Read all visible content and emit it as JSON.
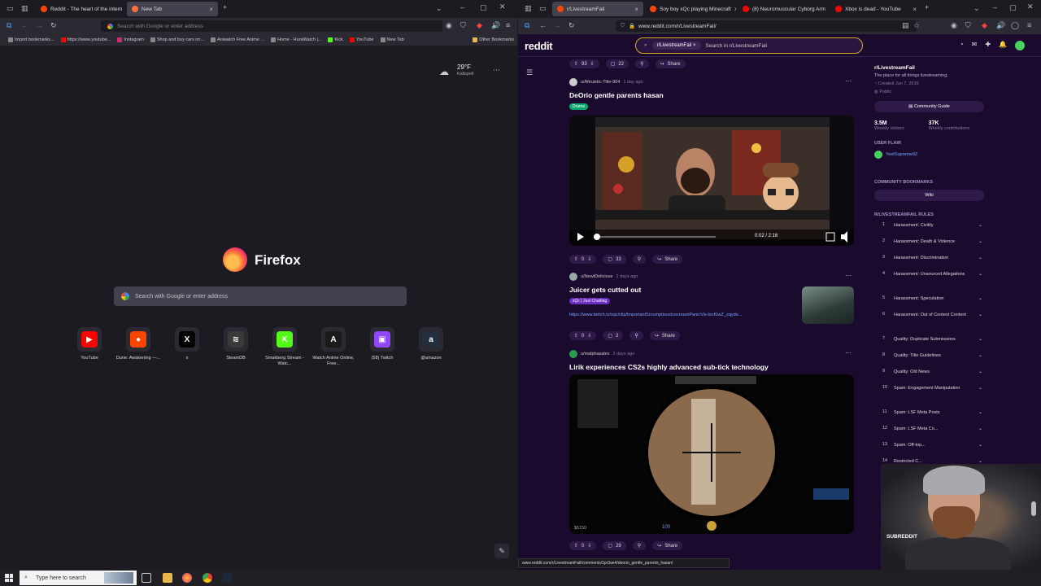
{
  "left_window": {
    "tabs": [
      {
        "label": "Reddit - The heart of the intern",
        "active": false
      },
      {
        "label": "New Tab",
        "active": true
      }
    ],
    "url_placeholder": "Search with Google or enter address",
    "bookmarks": [
      "Import bookmarks...",
      "https://www.youtube...",
      "Instagram",
      "Shop and buy cars on...",
      "Aniwatch Free Anime ...",
      "Home - HuraWatch |...",
      "Kick",
      "YouTube",
      "New Tab"
    ],
    "bookmarks_other": "Other Bookmarks",
    "weather": {
      "temp": "29°F",
      "city": "Kalispell"
    },
    "brand": "Firefox",
    "search_placeholder": "Search with Google or enter address",
    "shortcuts": [
      {
        "label": "YouTube",
        "color": "#ff0000",
        "glyph": "▶"
      },
      {
        "label": "Dune: Awakening —...",
        "color": "#ff4500",
        "glyph": "●"
      },
      {
        "label": "x",
        "color": "#000000",
        "glyph": "X"
      },
      {
        "label": "SteamDB",
        "color": "#3a3a3a",
        "glyph": "≋"
      },
      {
        "label": "Smakberg Stream - Watc...",
        "color": "#53fc18",
        "glyph": "K"
      },
      {
        "label": "Watch Anime Online, Free...",
        "color": "#1a1a1a",
        "glyph": "A"
      },
      {
        "label": "(58) Twitch",
        "color": "#9146ff",
        "glyph": "▣"
      },
      {
        "label": "@amazon",
        "color": "#232f3e",
        "glyph": "a"
      }
    ]
  },
  "right_window": {
    "tabs": [
      {
        "label": "r/LivestreamFail",
        "active": true
      },
      {
        "label": "Soy boy xQc playing Minecraft",
        "active": false
      },
      {
        "label": "(8) Neuromuscular Cyborg Arm",
        "active": false
      },
      {
        "label": "Xbox is dead - YouTube",
        "active": false
      }
    ],
    "url": "www.reddit.com/r/LivestreamFail/",
    "reddit": {
      "logo": "reddit",
      "search_chip": "r/LivestreamFail",
      "search_placeholder": "Search in r/LivestreamFail"
    },
    "feed": {
      "top_bar": {
        "votes": "93",
        "comments": "22",
        "share": "Share"
      },
      "posts": [
        {
          "author": "u/Altruistic-Title-904",
          "time": "1 day ago",
          "title": "DeOrio gentle parents hasan",
          "flair": "Drama",
          "video_time": "0:02 / 2:16",
          "votes": "0",
          "comments": "33",
          "share": "Share"
        },
        {
          "author": "u/NewtDelicious",
          "time": "2 days ago",
          "title": "Juicer gets cutted out",
          "flair": "xQc | Just Chatting",
          "link": "https://www.twitch.tv/xqc/clip/ImportantScrumptiousIcecreamPanicVis-locKtwZ_zqyde...",
          "votes": "0",
          "comments": "2",
          "share": "Share"
        },
        {
          "author": "u/malphasalex",
          "time": "2 days ago",
          "title": "Lirik experiences CS2s highly advanced sub-tick technology",
          "hud_money": "$5150",
          "hud_hp": "100",
          "votes": "0",
          "comments": "29",
          "share": "Share"
        }
      ]
    },
    "sidebar": {
      "title": "r/LivestreamFail",
      "description": "The place for all things livestreaming.",
      "created": "Created Jun 7, 2015",
      "visibility": "Public",
      "guide_button": "Community Guide",
      "stats": [
        {
          "value": "3.5M",
          "label": "Weekly visitors"
        },
        {
          "value": "37K",
          "label": "Weekly contributions"
        }
      ],
      "user_flair_heading": "USER FLAIR",
      "user_flair_name": "YeetSupreme92",
      "bookmarks_heading": "COMMUNITY BOOKMARKS",
      "wiki": "Wiki",
      "rules_heading": "R/LIVESTREAMFAIL RULES",
      "rules": [
        {
          "n": "1",
          "t": "Harassment: Civility"
        },
        {
          "n": "2",
          "t": "Harassment: Death & Violence"
        },
        {
          "n": "3",
          "t": "Harassment: Discrimination"
        },
        {
          "n": "4",
          "t": "Harassment: Unsourced Allegations"
        },
        {
          "n": "5",
          "t": "Harassment: Speculation"
        },
        {
          "n": "6",
          "t": "Harassment: Out of Context Content"
        },
        {
          "n": "7",
          "t": "Quality: Duplicate Submissions"
        },
        {
          "n": "8",
          "t": "Quality: Title Guidelines"
        },
        {
          "n": "9",
          "t": "Quality: Old News"
        },
        {
          "n": "10",
          "t": "Spam: Engagement Manipulation"
        },
        {
          "n": "11",
          "t": "Spam: LSF Meta Posts"
        },
        {
          "n": "12",
          "t": "Spam: LSF Meta Co..."
        },
        {
          "n": "13",
          "t": "Spam: Off-top..."
        },
        {
          "n": "14",
          "t": "Restricted C..."
        }
      ],
      "subreddit_button": "SUBREDDIT"
    },
    "status_url": "www.reddit.com/r/LivestreamFail/comments/1pr3ae4/deorio_gentle_parents_hasan/"
  },
  "taskbar": {
    "search_placeholder": "Type here to search"
  }
}
